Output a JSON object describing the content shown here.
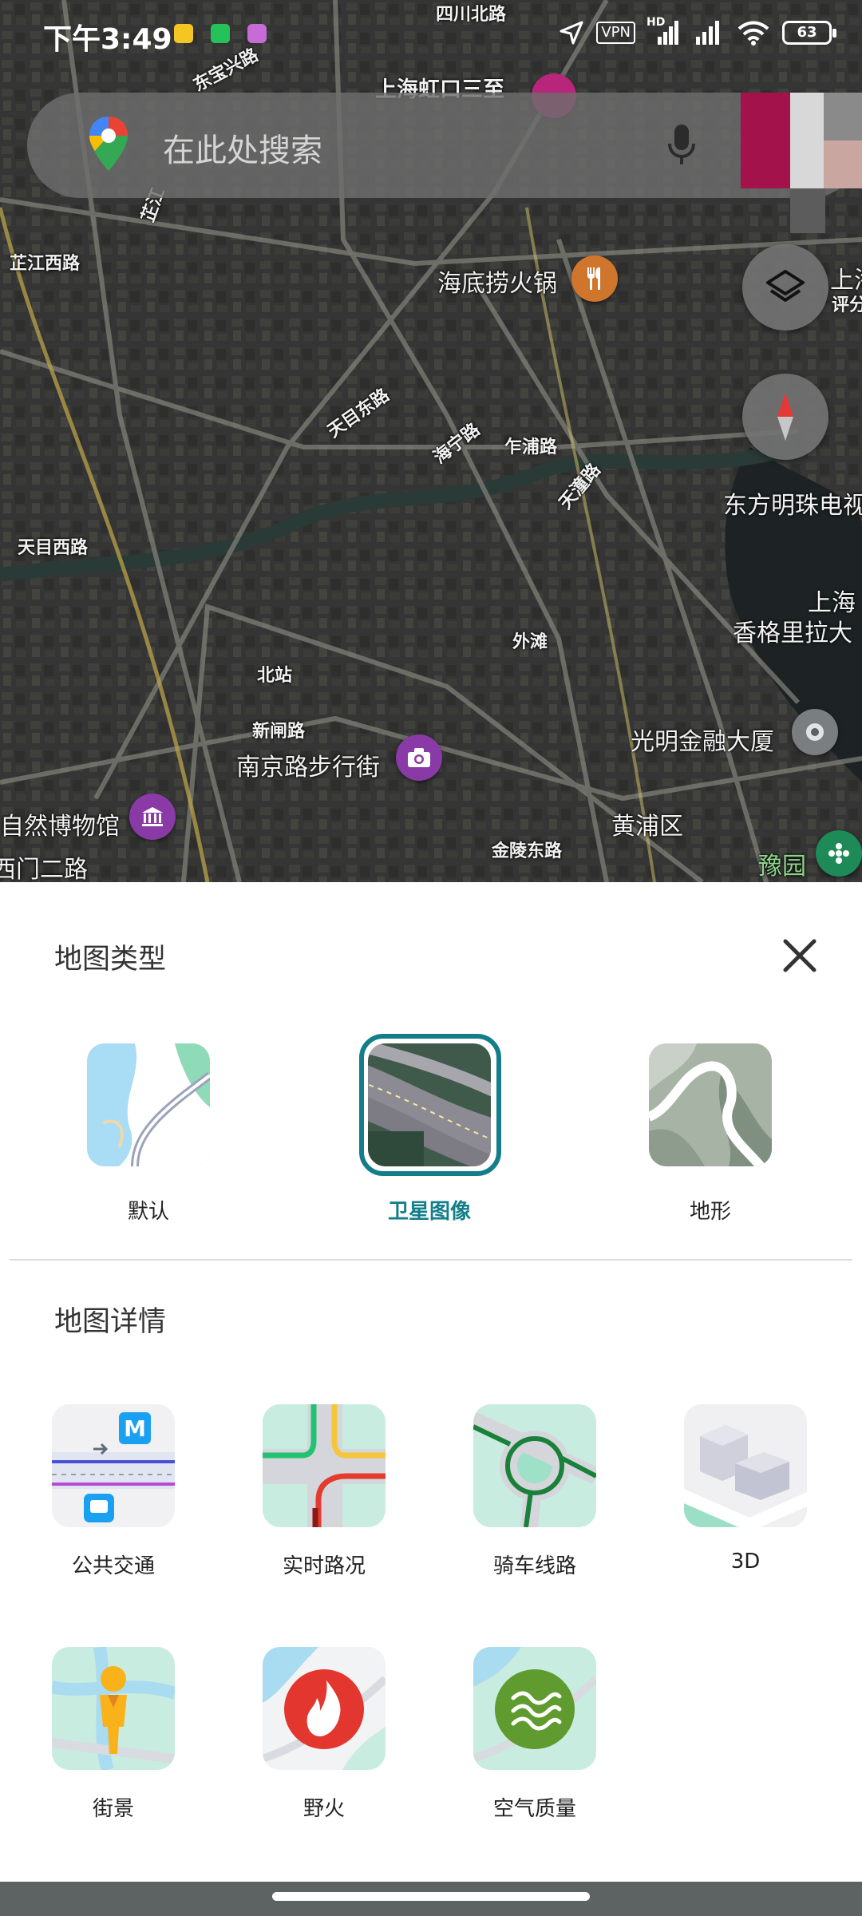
{
  "status_bar": {
    "time": "下午3:49",
    "vpn": "VPN",
    "hd": "HD",
    "battery": "63"
  },
  "search": {
    "placeholder": "在此处搜索"
  },
  "map": {
    "labels": {
      "sichuan_rd": "四川北路",
      "dongbaoxing_rd": "东宝兴路",
      "hongkou_sanjiao": "上海虹口三至",
      "zhijiang_rd_top": "芷江",
      "zhijiang_west_rd": "芷江西路",
      "haidilao": "海底捞火锅",
      "shang": "上海",
      "pingfen": "评分",
      "tianmu_east_rd": "天目东路",
      "haining_rd": "海宁路",
      "zhapu_rd": "乍浦路",
      "tiantong_rd": "天潼路",
      "oriental_pearl": "东方明珠电视",
      "tianmu_west_rd": "天目西路",
      "shanghai_right": "上海",
      "shangri_la": "香格里拉大",
      "waitan": "外滩",
      "beizhan": "北站",
      "xinzha_rd": "新闸路",
      "nanjing_rd": "南京路步行街",
      "guangming": "光明金融大厦",
      "museum": "自然博物馆",
      "huangpu": "黄浦区",
      "ximen_rd": "西门二路",
      "jinling_rd": "金陵东路",
      "yuyuan": "豫园"
    }
  },
  "sheet": {
    "map_type_title": "地图类型",
    "map_types": [
      {
        "label": "默认"
      },
      {
        "label": "卫星图像",
        "selected": true
      },
      {
        "label": "地形"
      }
    ],
    "map_details_title": "地图详情",
    "details": [
      {
        "label": "公共交通"
      },
      {
        "label": "实时路况"
      },
      {
        "label": "骑车线路"
      },
      {
        "label": "3D"
      },
      {
        "label": "街景"
      },
      {
        "label": "野火"
      },
      {
        "label": "空气质量"
      }
    ]
  },
  "colors": {
    "accent": "#137e8a",
    "poi_orange": "#d0762c",
    "poi_purple": "#8a3aa6",
    "poi_green": "#1e8a57"
  }
}
